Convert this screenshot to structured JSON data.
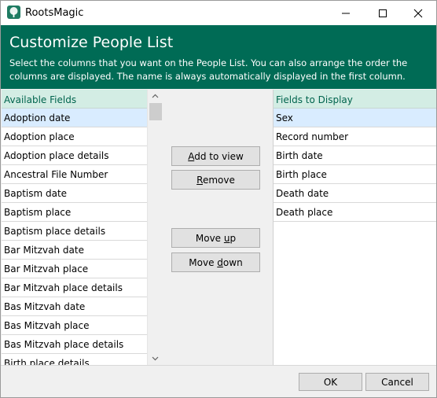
{
  "window": {
    "title": "RootsMagic",
    "icon": "tree-app-icon",
    "controls": [
      "minimize-icon",
      "maximize-icon",
      "close-icon"
    ]
  },
  "header": {
    "title": "Customize People List",
    "description": "Select the columns that you want on the People List. You can also arrange the order the columns are displayed. The name is always automatically displayed in the first column."
  },
  "available": {
    "header": "Available Fields",
    "items": [
      "Adoption date",
      "Adoption place",
      "Adoption place details",
      "Ancestral File Number",
      "Baptism date",
      "Baptism place",
      "Baptism place details",
      "Bar Mitzvah date",
      "Bar Mitzvah place",
      "Bar Mitzvah place details",
      "Bas Mitzvah date",
      "Bas Mitzvah place",
      "Bas Mitzvah place details",
      "Birth place details"
    ],
    "selected_index": 0
  },
  "display": {
    "header": "Fields to Display",
    "items": [
      "Sex",
      "Record number",
      "Birth date",
      "Birth place",
      "Death date",
      "Death place"
    ],
    "selected_index": 0
  },
  "actions": {
    "add_label": "Add to view",
    "add_key": "A",
    "add_rest": "dd to view",
    "remove_key": "R",
    "remove_rest": "emove",
    "move_up_pre": "Move ",
    "move_up_key": "u",
    "move_up_post": "p",
    "move_down_pre": "Move ",
    "move_down_key": "d",
    "move_down_post": "own"
  },
  "footer": {
    "ok_label": "OK",
    "cancel_label": "Cancel"
  },
  "colors": {
    "header_bg": "#006b55",
    "list_header_bg": "#d3ede4",
    "list_header_text": "#00644d",
    "selection": "#d9ecff"
  }
}
